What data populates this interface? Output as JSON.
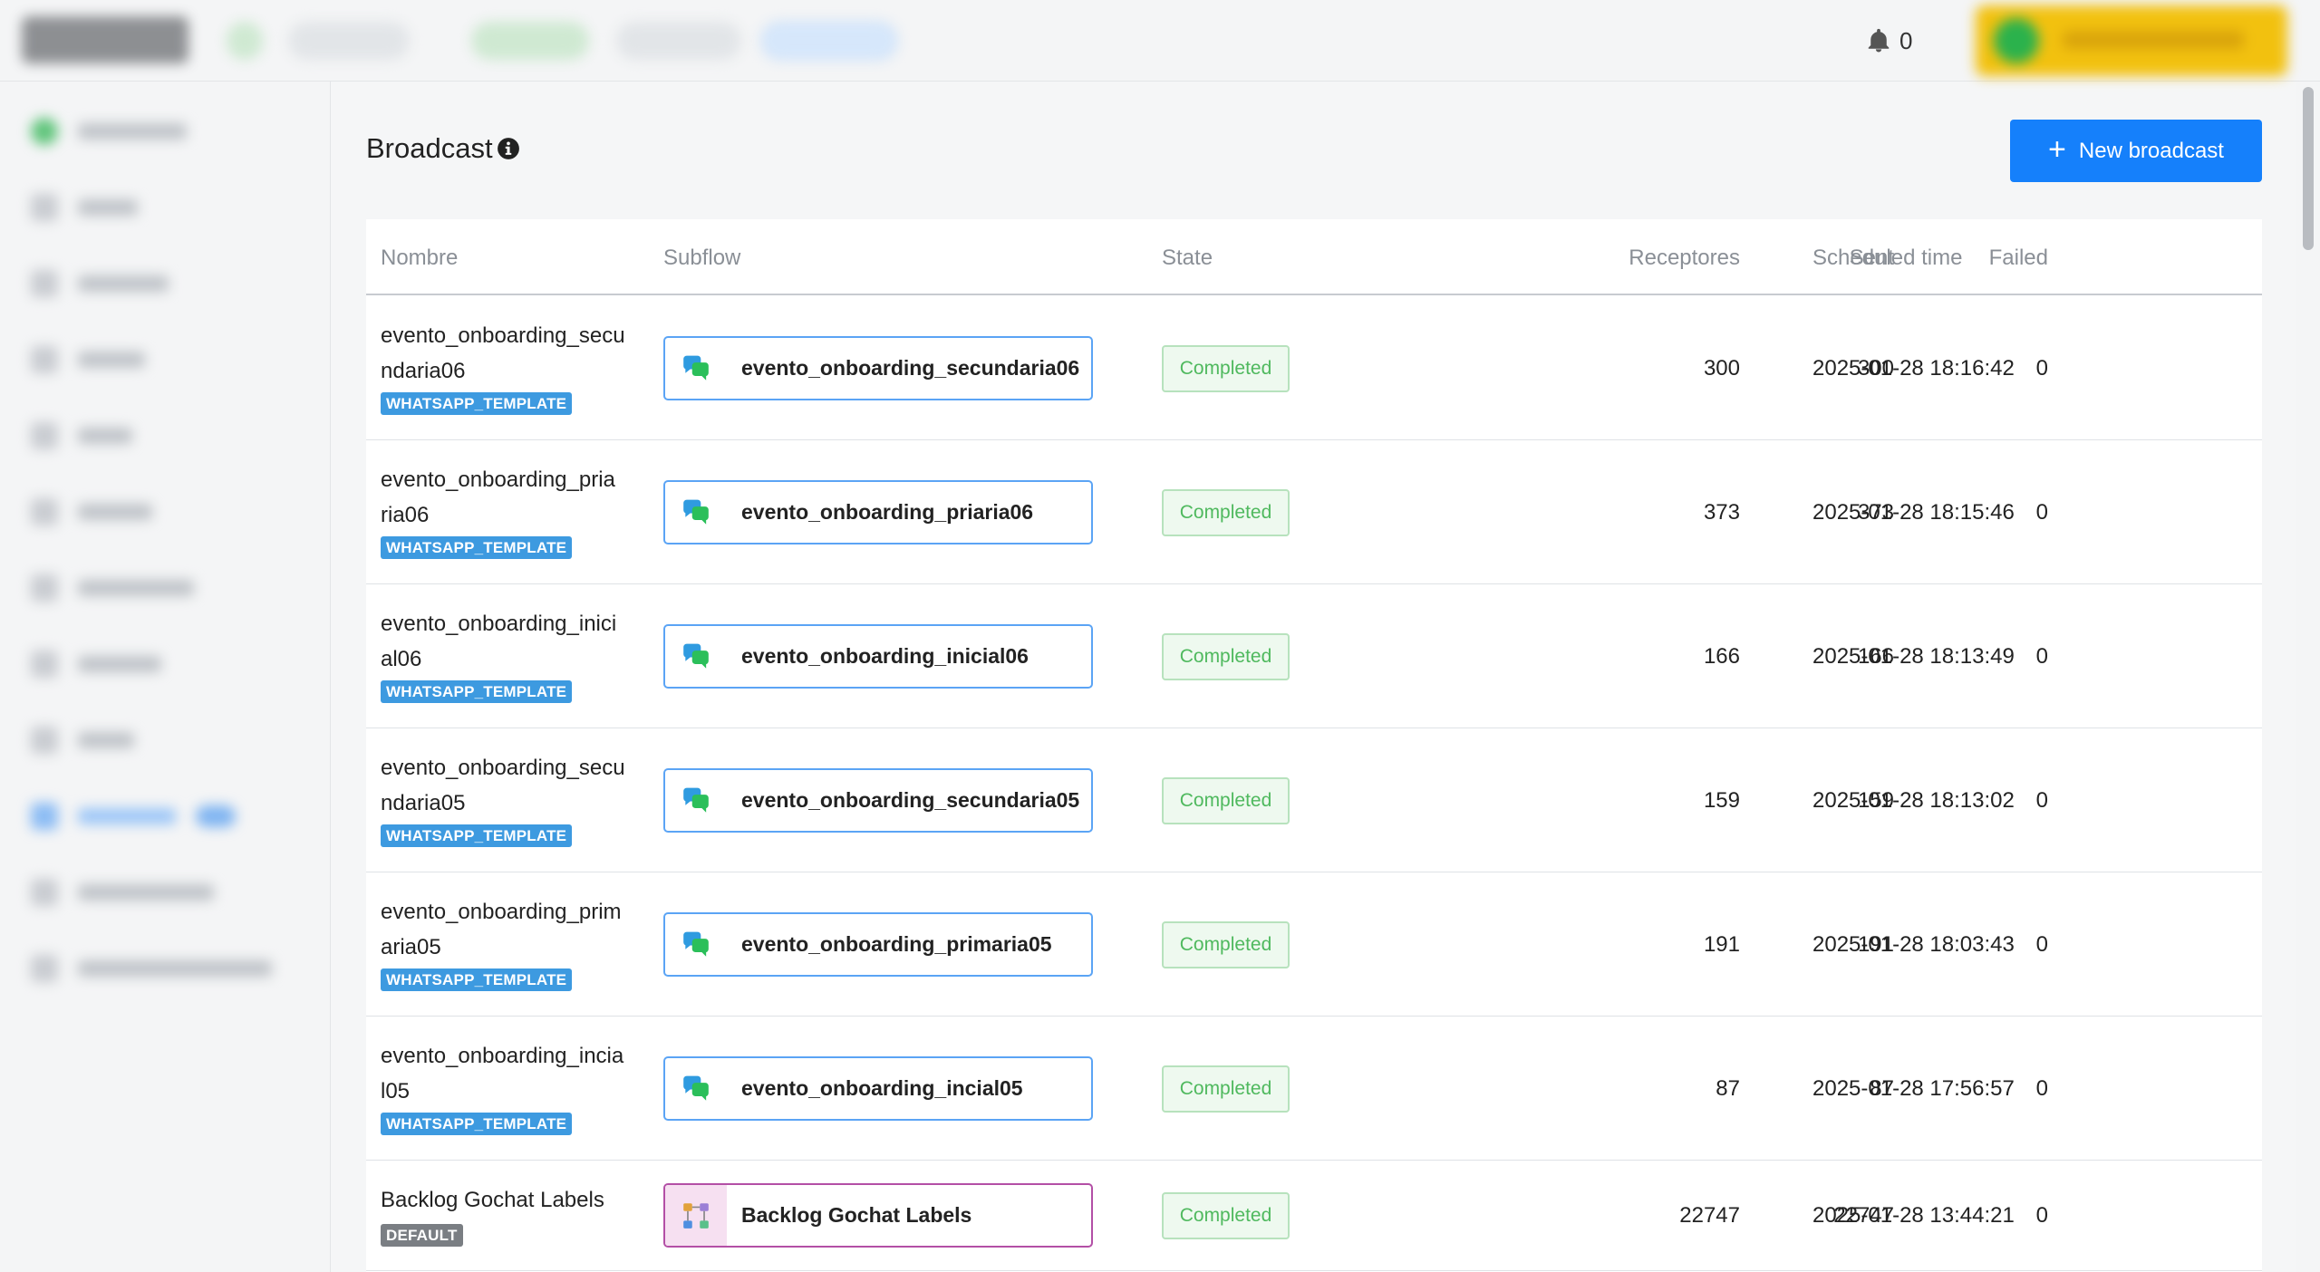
{
  "header": {
    "notifications_count": "0"
  },
  "page": {
    "title": "Broadcast",
    "new_button_label": "New broadcast"
  },
  "table": {
    "columns": {
      "name": "Nombre",
      "subflow": "Subflow",
      "state": "State",
      "receptores": "Receptores",
      "sent": "Sent",
      "failed": "Failed",
      "scheduled": "Scheduled time"
    },
    "rows": [
      {
        "name_line1": "evento_onboarding_secu",
        "name_line2": "ndaria06",
        "tag": "WHATSAPP_TEMPLATE",
        "subflow": "evento_onboarding_secundaria06",
        "subflow_icon": "whatsapp-chat-icon",
        "state": "Completed",
        "receptores": "300",
        "sent": "300",
        "failed": "0",
        "scheduled": "2025-01-28 18:16:42"
      },
      {
        "name_line1": "evento_onboarding_pria",
        "name_line2": "ria06",
        "tag": "WHATSAPP_TEMPLATE",
        "subflow": "evento_onboarding_priaria06",
        "subflow_icon": "whatsapp-chat-icon",
        "state": "Completed",
        "receptores": "373",
        "sent": "373",
        "failed": "0",
        "scheduled": "2025-01-28 18:15:46"
      },
      {
        "name_line1": "evento_onboarding_inici",
        "name_line2": "al06",
        "tag": "WHATSAPP_TEMPLATE",
        "subflow": "evento_onboarding_inicial06",
        "subflow_icon": "whatsapp-chat-icon",
        "state": "Completed",
        "receptores": "166",
        "sent": "166",
        "failed": "0",
        "scheduled": "2025-01-28 18:13:49"
      },
      {
        "name_line1": "evento_onboarding_secu",
        "name_line2": "ndaria05",
        "tag": "WHATSAPP_TEMPLATE",
        "subflow": "evento_onboarding_secundaria05",
        "subflow_icon": "whatsapp-chat-icon",
        "state": "Completed",
        "receptores": "159",
        "sent": "159",
        "failed": "0",
        "scheduled": "2025-01-28 18:13:02"
      },
      {
        "name_line1": "evento_onboarding_prim",
        "name_line2": "aria05",
        "tag": "WHATSAPP_TEMPLATE",
        "subflow": "evento_onboarding_primaria05",
        "subflow_icon": "whatsapp-chat-icon",
        "state": "Completed",
        "receptores": "191",
        "sent": "191",
        "failed": "0",
        "scheduled": "2025-01-28 18:03:43"
      },
      {
        "name_line1": "evento_onboarding_incia",
        "name_line2": "l05",
        "tag": "WHATSAPP_TEMPLATE",
        "subflow": "evento_onboarding_incial05",
        "subflow_icon": "whatsapp-chat-icon",
        "state": "Completed",
        "receptores": "87",
        "sent": "87",
        "failed": "0",
        "scheduled": "2025-01-28 17:56:57"
      },
      {
        "name_line1": "Backlog Gochat Labels",
        "name_line2": "",
        "tag": "DEFAULT",
        "subflow": "Backlog Gochat Labels",
        "subflow_icon": "flow-diagram-icon",
        "state": "Completed",
        "receptores": "22747",
        "sent": "22747",
        "failed": "0",
        "scheduled": "2025-01-28 13:44:21"
      }
    ]
  },
  "colors": {
    "primary": "#1580fb",
    "completed_text": "#4fb95e",
    "whatsapp_tag": "#3d9ae0",
    "default_tag": "#7a7e83",
    "user_chip": "#f2c10f"
  }
}
